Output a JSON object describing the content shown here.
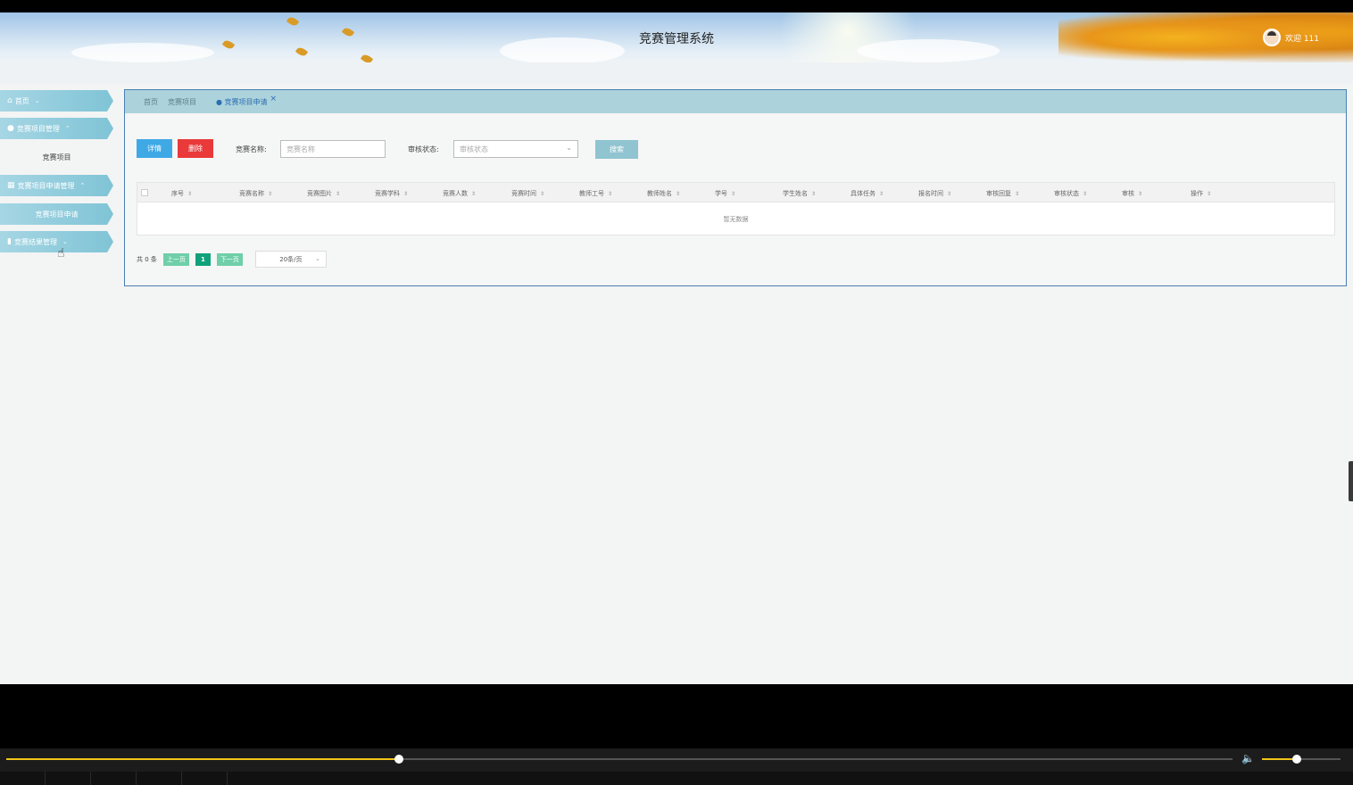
{
  "header": {
    "title": "竞赛管理系统",
    "welcome": "欢迎 111"
  },
  "sidebar": {
    "items": [
      {
        "label": "首页",
        "icon": "home-icon",
        "chevron": "⌄"
      },
      {
        "label": "竞赛项目管理",
        "icon": "project-icon",
        "chevron": "⌃",
        "sub": "竞赛项目"
      },
      {
        "label": "竞赛项目申请管理",
        "icon": "grid-icon",
        "chevron": "⌃",
        "sub": "竞赛项目申请"
      },
      {
        "label": "竞赛结果管理",
        "icon": "book-icon",
        "chevron": "⌄"
      }
    ]
  },
  "tabs": {
    "crumbs": [
      "首页",
      "竞赛项目"
    ],
    "active": "竞赛项目申请",
    "close": "×"
  },
  "toolbar": {
    "detail": "详情",
    "delete": "删除",
    "name_label": "竞赛名称:",
    "name_placeholder": "竞赛名称",
    "status_label": "审核状态:",
    "status_placeholder": "审核状态",
    "search": "搜索"
  },
  "table": {
    "columns": [
      "序号",
      "竞赛名称",
      "竞赛图片",
      "竞赛学科",
      "竞赛人数",
      "竞赛时间",
      "教师工号",
      "教师姓名",
      "学号",
      "学生姓名",
      "具体任务",
      "报名时间",
      "审核回复",
      "审核状态",
      "审核",
      "操作"
    ],
    "empty": "暂无数据"
  },
  "pager": {
    "total": "共 0 条",
    "prev": "上一页",
    "page": "1",
    "next": "下一页",
    "size": "20条/页"
  },
  "player": {
    "progress_fraction": 0.32,
    "volume_fraction": 0.44
  },
  "colors": {
    "accent": "#7fc4d6",
    "danger": "#e9393a",
    "primary": "#3fa9e6",
    "page_active": "#0fa27a",
    "progress": "#f0c419"
  }
}
